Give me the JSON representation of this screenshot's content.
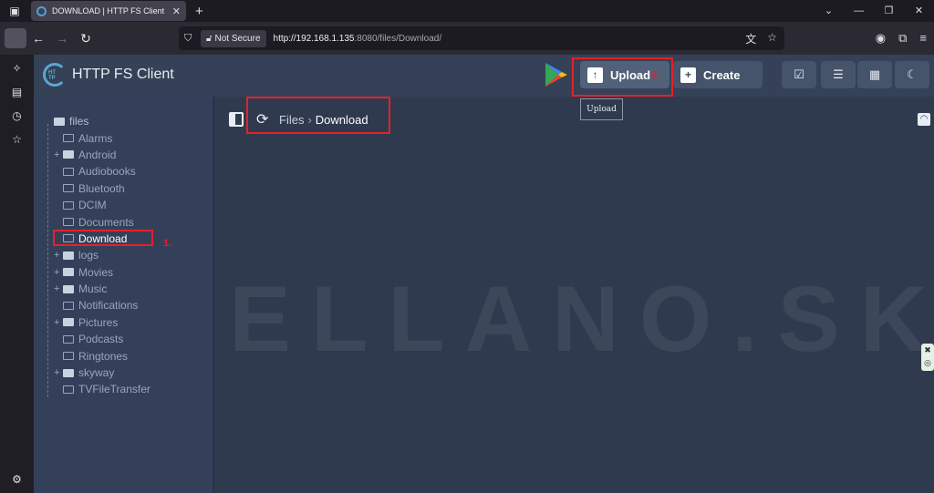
{
  "browser": {
    "tab_title": "DOWNLOAD | HTTP FS Client",
    "tab_close": "✕",
    "new_tab": "+",
    "not_secure": "Not Secure",
    "url_host": "http://192.168.1.135",
    "url_path": ":8080/files/Download/"
  },
  "app": {
    "title": "HTTP FS Client",
    "logo_text": "HT TP",
    "upload_label": "Upload",
    "create_label": "Create",
    "tooltip": "Upload",
    "annotation_1": "1.",
    "annotation_2": "2."
  },
  "breadcrumb": {
    "root": "Files",
    "separator": "›",
    "current": "Download"
  },
  "tree": {
    "root": "files",
    "items": [
      {
        "label": "Alarms",
        "expandable": false
      },
      {
        "label": "Android",
        "expandable": true
      },
      {
        "label": "Audiobooks",
        "expandable": false
      },
      {
        "label": "Bluetooth",
        "expandable": false
      },
      {
        "label": "DCIM",
        "expandable": false
      },
      {
        "label": "Documents",
        "expandable": false
      },
      {
        "label": "Download",
        "expandable": false,
        "active": true
      },
      {
        "label": "logs",
        "expandable": true
      },
      {
        "label": "Movies",
        "expandable": true
      },
      {
        "label": "Music",
        "expandable": true
      },
      {
        "label": "Notifications",
        "expandable": false
      },
      {
        "label": "Pictures",
        "expandable": true
      },
      {
        "label": "Podcasts",
        "expandable": false
      },
      {
        "label": "Ringtones",
        "expandable": false
      },
      {
        "label": "skyway",
        "expandable": true
      },
      {
        "label": "TVFileTransfer",
        "expandable": false
      }
    ]
  },
  "watermark": "ELLANO.SK",
  "colors": {
    "highlight": "#e5202a",
    "accent": "#5aa7d0",
    "panel": "#34405a",
    "background": "#2f3a4e"
  }
}
